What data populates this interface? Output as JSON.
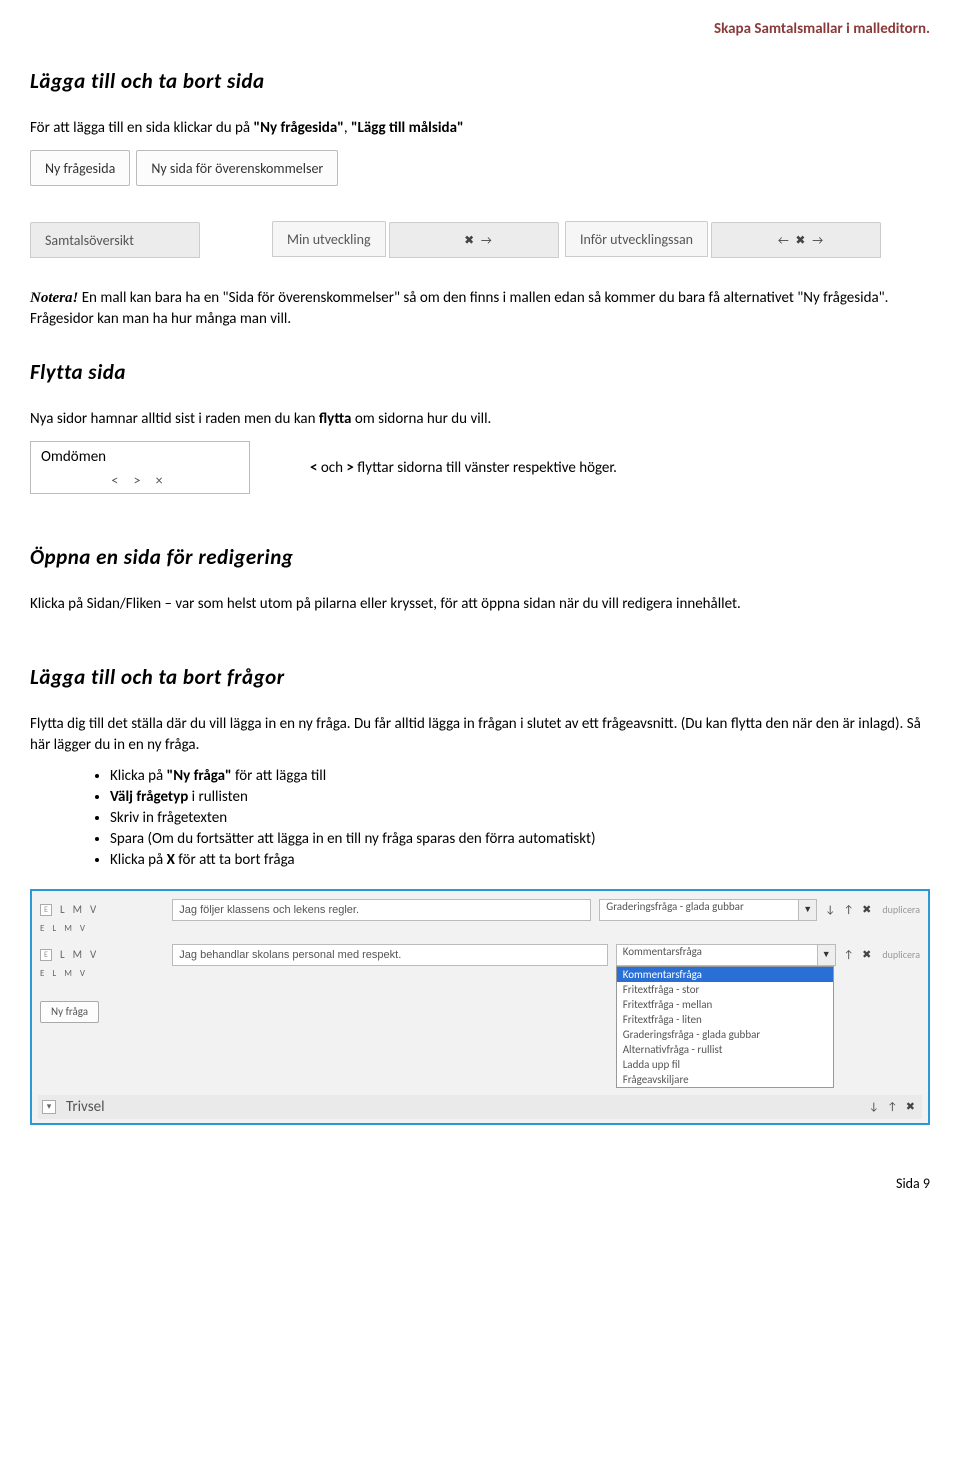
{
  "header": "Skapa Samtalsmallar i malleditorn.",
  "s1": {
    "title": "Lägga till och ta bort sida",
    "intro_pre": "För att lägga till en sida klickar du på ",
    "intro_q1": "\"Ny frågesida\"",
    "intro_mid": ", ",
    "intro_q2": "\"Lägg till målsida\"",
    "btn_ny_fragesida": "Ny frågesida",
    "btn_ny_sida_overens": "Ny sida för överenskommelser",
    "tab_samtalsoversikt": "Samtalsöversikt",
    "tab_min_utveckling": "Min utveckling",
    "tab_infor": "Inför utvecklingssan",
    "tab_ctrl_a": "✖ →",
    "tab_ctrl_b": "← ✖ →",
    "notera_label": "Notera!",
    "notera_body": " En mall kan bara ha en \"Sida för överenskommelser\" så om den finns i mallen edan så kommer du bara få alternativet \"Ny frågesida\". Frågesidor kan man ha hur många man vill."
  },
  "s2": {
    "title": "Flytta sida",
    "body_pre": "Nya sidor hamnar alltid sist i raden men du kan ",
    "body_bold": "flytta",
    "body_post": " om sidorna hur du vill.",
    "omdomen": "Omdömen",
    "omdomen_ctrl": "<  >  ×",
    "note_pre": "< ",
    "note_mid1": "och",
    "note_mid2": " > ",
    "note_post": "flyttar sidorna till vänster respektive höger."
  },
  "s3": {
    "title": "Öppna en sida för redigering",
    "body": "Klicka på Sidan/Fliken – var som helst utom på pilarna eller krysset,  för att öppna sidan när du vill redigera innehållet."
  },
  "s4": {
    "title": "Lägga till och ta bort frågor",
    "body": "Flytta dig till det ställa där du vill lägga in en ny fråga. Du får alltid lägga in frågan i slutet av ett frågeavsnitt. (Du kan flytta den när den är inlagd). Så här lägger du in en ny fråga.",
    "b1a": "Klicka på ",
    "b1b": "\"Ny fråga\"",
    "b1c": " för att lägga till",
    "b2a": "Välj frågetyp",
    "b2b": " i rullisten",
    "b3": "Skriv in frågetexten",
    "b4": "Spara (Om du fortsätter att lägga in en till ny fråga sparas den förra automatiskt)",
    "b5a": "Klicka på ",
    "b5b": "X",
    "b5c": " för att ta bort fråga"
  },
  "ed": {
    "lvl": [
      "E",
      "L",
      "M",
      "V"
    ],
    "q1": "Jag följer klassens och lekens regler.",
    "q1_type": "Graderingsfråga - glada gubbar",
    "q2": "Jag behandlar skolans personal med respekt.",
    "q2_type": "Kommentarsfråga",
    "options": [
      "Kommentarsfråga",
      "Fritextfråga - stor",
      "Fritextfråga - mellan",
      "Fritextfråga - liten",
      "Graderingsfråga - glada gubbar",
      "Alternativfråga - rullist",
      "Ladda upp fil",
      "Frågeavskiljare"
    ],
    "icons_row1": "↓ ↑ ✖",
    "icons_row2": "↑ ✖",
    "dup": "duplicera",
    "new_btn": "Ny fråga",
    "section": "Trivsel",
    "section_icons": "↓ ↑ ✖"
  },
  "footer": "Sida 9"
}
